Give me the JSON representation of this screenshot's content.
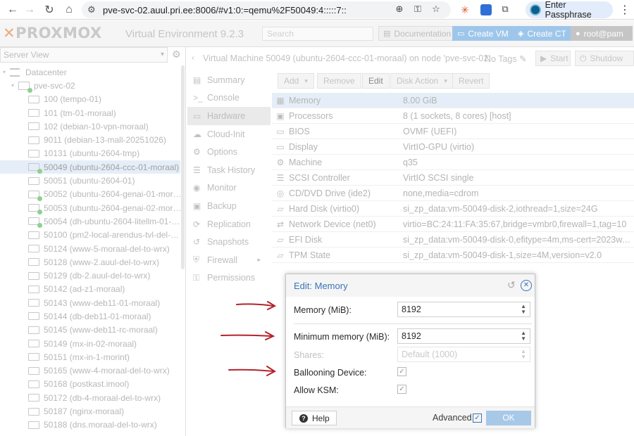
{
  "browser": {
    "url": "pve-svc-02.auul.pri.ee:8006/#v1:0:=qemu%2F50049:4:::::7::",
    "passphrase_label": "Enter Passphrase",
    "colors": {
      "passphrase_bg": "#e3ecfa",
      "accent": "#3a73b8"
    }
  },
  "header": {
    "logo": "PROXMOX",
    "version": "Virtual Environment 9.2.3",
    "search_placeholder": "Search",
    "documentation": "Documentation",
    "create_vm": "Create VM",
    "create_ct": "Create CT",
    "user": "root@pam"
  },
  "left": {
    "view": "Server View",
    "tree": [
      {
        "label": "Datacenter",
        "kind": "datacenter"
      },
      {
        "label": "pve-svc-02",
        "kind": "node"
      },
      {
        "label": "100 (tempo-01)",
        "kind": "vm",
        "running": false
      },
      {
        "label": "101 (tm-01-moraal)",
        "kind": "vm",
        "running": false
      },
      {
        "label": "102 (debian-10-vpn-moraal)",
        "kind": "vm",
        "running": false
      },
      {
        "label": "9011 (debian-13-mall-20251026)",
        "kind": "vm",
        "running": false
      },
      {
        "label": "10131 (ubuntu-2604-tmp)",
        "kind": "vm",
        "running": false
      },
      {
        "label": "50049 (ubuntu-2604-ccc-01-moraal)",
        "kind": "vm",
        "running": true,
        "selected": true
      },
      {
        "label": "50051 (ubuntu-2604-01)",
        "kind": "vm",
        "running": false
      },
      {
        "label": "50052 (ubuntu-2604-genai-01-mor…",
        "kind": "vm",
        "running": true
      },
      {
        "label": "50053 (ubuntu-2604-genai-02-mor…",
        "kind": "vm",
        "running": true
      },
      {
        "label": "50054 (dh-ubuntu-2604-litellm-01-…",
        "kind": "vm",
        "running": true
      },
      {
        "label": "50100 (pm2-local-arendus-tvl-del-…",
        "kind": "vm",
        "running": false
      },
      {
        "label": "50124 (www-5-moraal-del-to-wrx)",
        "kind": "vm",
        "running": false
      },
      {
        "label": "50128 (www-2.auul-del-to-wrx)",
        "kind": "vm",
        "running": false
      },
      {
        "label": "50129 (db-2.auul-del-to-wrx)",
        "kind": "vm",
        "running": false
      },
      {
        "label": "50142 (ad-z1-moraal)",
        "kind": "vm",
        "running": false
      },
      {
        "label": "50143 (www-deb11-01-moraal)",
        "kind": "vm",
        "running": false
      },
      {
        "label": "50144 (db-deb11-01-moraal)",
        "kind": "vm",
        "running": false
      },
      {
        "label": "50145 (www-deb11-rc-moraal)",
        "kind": "vm",
        "running": false
      },
      {
        "label": "50149 (mx-in-02-moraal)",
        "kind": "vm",
        "running": false
      },
      {
        "label": "50151 (mx-in-1-morint)",
        "kind": "vm",
        "running": false
      },
      {
        "label": "50165 (www-4-moraal-del-to-wrx)",
        "kind": "vm",
        "running": false
      },
      {
        "label": "50168 (postkast.imool)",
        "kind": "vm",
        "running": false
      },
      {
        "label": "50172 (db-4-moraal-del-to-wrx)",
        "kind": "vm",
        "running": false
      },
      {
        "label": "50187 (nginx-moraal)",
        "kind": "vm",
        "running": false
      },
      {
        "label": "50188 (dns.moraal-del-to-wrx)",
        "kind": "vm",
        "running": false
      }
    ]
  },
  "content": {
    "title": "Virtual Machine 50049 (ubuntu-2604-ccc-01-moraal) on node 'pve-svc-02'",
    "tags": "No Tags",
    "start": "Start",
    "shutdown": "Shutdow"
  },
  "confnav": [
    {
      "label": "Summary",
      "icon": "summary-icon"
    },
    {
      "label": "Console",
      "icon": "console-icon"
    },
    {
      "label": "Hardware",
      "icon": "hardware-icon",
      "active": true
    },
    {
      "label": "Cloud-Init",
      "icon": "cloud-icon"
    },
    {
      "label": "Options",
      "icon": "options-icon"
    },
    {
      "label": "Task History",
      "icon": "task-history-icon"
    },
    {
      "label": "Monitor",
      "icon": "monitor-icon"
    },
    {
      "label": "Backup",
      "icon": "backup-icon"
    },
    {
      "label": "Replication",
      "icon": "replication-icon"
    },
    {
      "label": "Snapshots",
      "icon": "snapshots-icon"
    },
    {
      "label": "Firewall",
      "icon": "firewall-icon",
      "more": true
    },
    {
      "label": "Permissions",
      "icon": "permissions-icon"
    }
  ],
  "toolbar": {
    "add": "Add",
    "remove": "Remove",
    "edit": "Edit",
    "disk_action": "Disk Action",
    "revert": "Revert"
  },
  "hardware": [
    {
      "icon": "memory-icon",
      "name": "Memory",
      "value": "8.00 GiB",
      "selected": true
    },
    {
      "icon": "processor-icon",
      "name": "Processors",
      "value": "8 (1 sockets, 8 cores) [host]"
    },
    {
      "icon": "bios-icon",
      "name": "BIOS",
      "value": "OVMF (UEFI)"
    },
    {
      "icon": "display-icon",
      "name": "Display",
      "value": "VirtIO-GPU (virtio)"
    },
    {
      "icon": "machine-icon",
      "name": "Machine",
      "value": "q35"
    },
    {
      "icon": "scsi-icon",
      "name": "SCSI Controller",
      "value": "VirtIO SCSI single"
    },
    {
      "icon": "cdrom-icon",
      "name": "CD/DVD Drive (ide2)",
      "value": "none,media=cdrom"
    },
    {
      "icon": "harddisk-icon",
      "name": "Hard Disk (virtio0)",
      "value": "si_zp_data:vm-50049-disk-2,iothread=1,size=24G"
    },
    {
      "icon": "network-icon",
      "name": "Network Device (net0)",
      "value": "virtio=BC:24:11:FA:35:67,bridge=vmbr0,firewall=1,tag=10"
    },
    {
      "icon": "efidisk-icon",
      "name": "EFI Disk",
      "value": "si_zp_data:vm-50049-disk-0,efitype=4m,ms-cert=2023w,pre…"
    },
    {
      "icon": "tpm-icon",
      "name": "TPM State",
      "value": "si_zp_data:vm-50049-disk-1,size=4M,version=v2.0"
    }
  ],
  "dialog": {
    "title": "Edit: Memory",
    "memory_label": "Memory (MiB):",
    "memory_value": "8192",
    "min_memory_label": "Minimum memory (MiB):",
    "min_memory_value": "8192",
    "shares_label": "Shares:",
    "shares_value": "Default (1000)",
    "ballooning_label": "Ballooning Device:",
    "ballooning_checked": true,
    "ksm_label": "Allow KSM:",
    "ksm_checked": true,
    "help": "Help",
    "advanced": "Advanced",
    "advanced_checked": true,
    "ok": "OK"
  },
  "annotations": {
    "arrow_color": "#b4232a"
  }
}
